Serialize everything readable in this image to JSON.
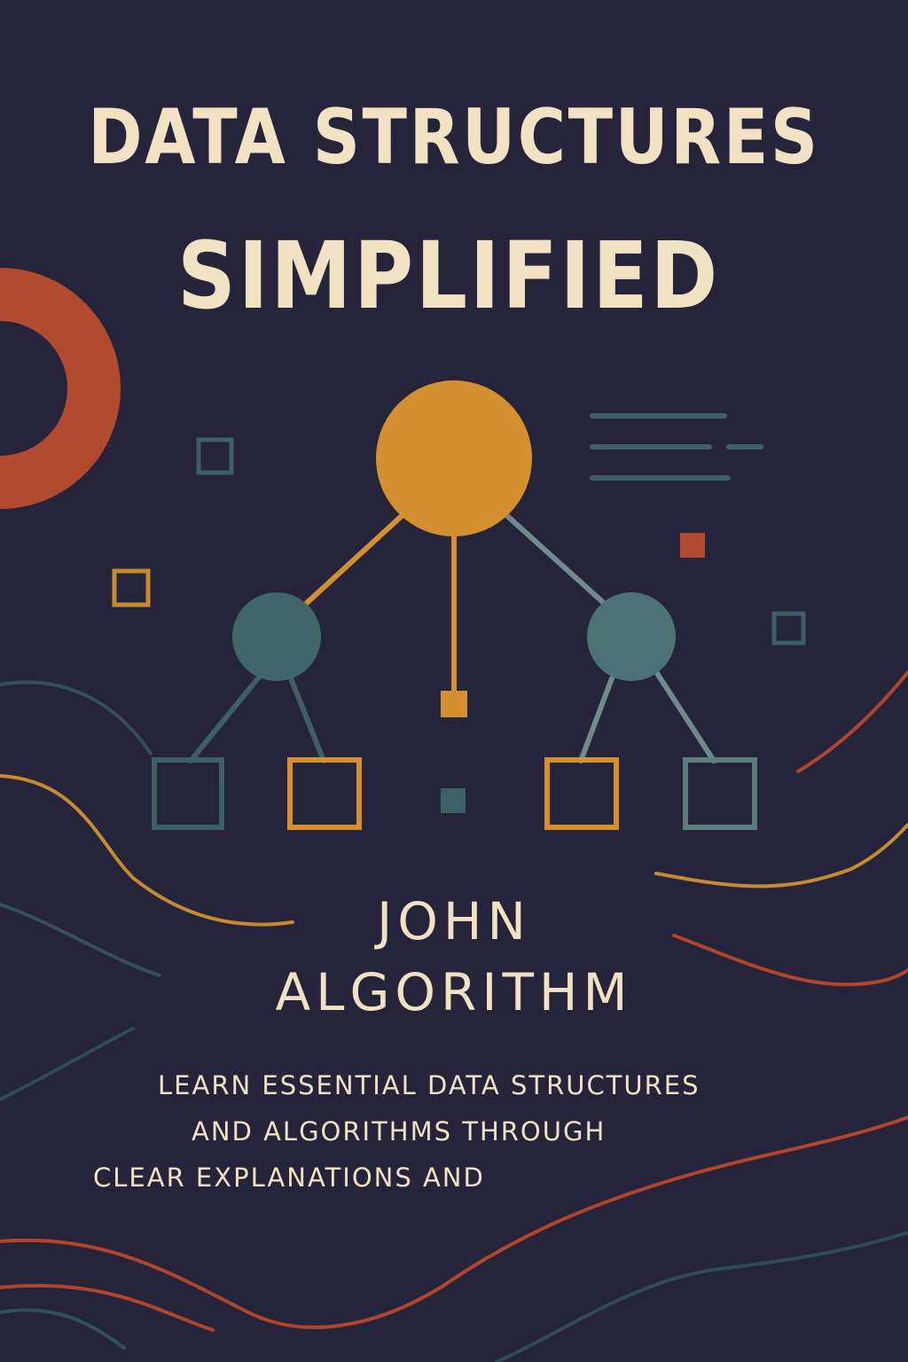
{
  "cover": {
    "title_line1": "DATA STRUCTURES",
    "title_line2": "SIMPLIFIED",
    "author_line1": "JOHN",
    "author_line2": "ALGORITHM",
    "tagline": [
      "LEARN ESSENTIAL DATA STRUCTURES",
      "AND ALGORITHMS THROUGH",
      "CLEAR EXPLANATIONS AND"
    ]
  },
  "colors": {
    "background": "#25243a",
    "cream": "#f1e2c4",
    "gold": "#d4902f",
    "teal": "#41666a",
    "rust": "#b14a2e"
  },
  "icons": [
    "ring-shape",
    "tree-diagram",
    "text-lines-glyph",
    "wave-lines"
  ]
}
